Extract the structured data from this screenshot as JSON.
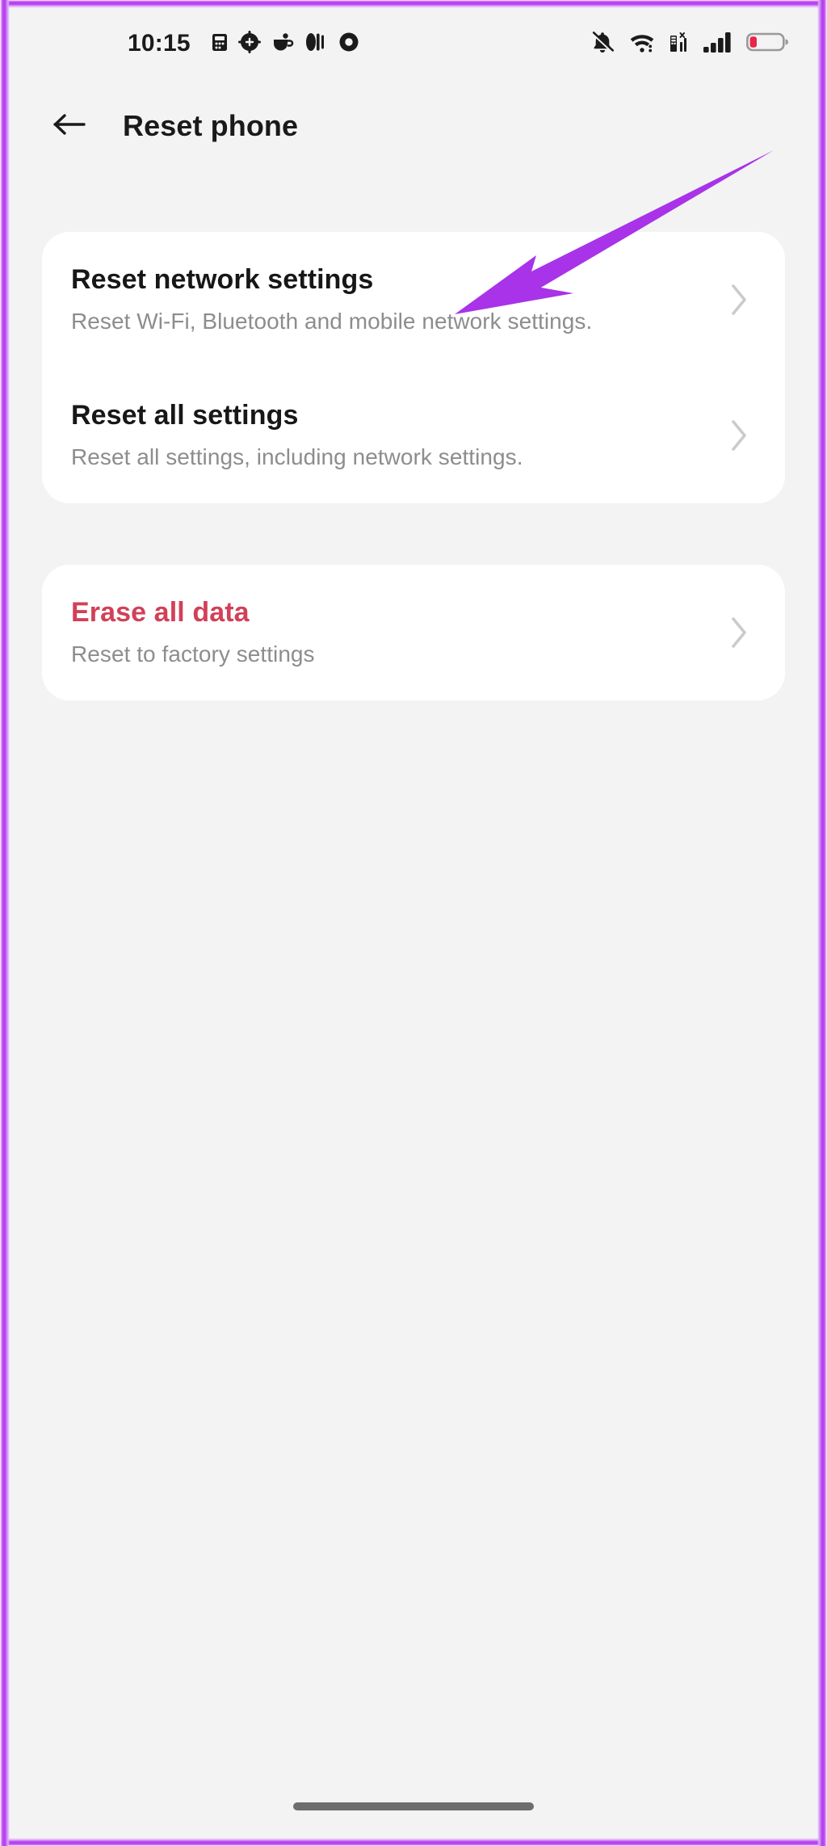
{
  "status_bar": {
    "time": "10:15",
    "left_icons": [
      {
        "name": "calculator-notification-icon"
      },
      {
        "name": "compass-notification-icon"
      },
      {
        "name": "coffee-notification-icon"
      },
      {
        "name": "music-notification-icon"
      },
      {
        "name": "recorder-notification-icon"
      }
    ],
    "right_icons": [
      {
        "name": "notifications-muted-icon"
      },
      {
        "name": "wifi-icon"
      },
      {
        "name": "sim-signal-icon"
      },
      {
        "name": "cellular-signal-icon"
      },
      {
        "name": "battery-low-icon"
      }
    ],
    "battery_level_percent": 15
  },
  "app_bar": {
    "back_label": "Back",
    "title": "Reset phone"
  },
  "cards": [
    {
      "id": "reset-settings-card",
      "rows": [
        {
          "id": "reset-network-settings",
          "title": "Reset network settings",
          "subtitle": "Reset Wi-Fi, Bluetooth and mobile network settings.",
          "danger": false
        },
        {
          "id": "reset-all-settings",
          "title": "Reset all settings",
          "subtitle": "Reset all settings, including network settings.",
          "danger": false
        }
      ]
    },
    {
      "id": "erase-card",
      "rows": [
        {
          "id": "erase-all-data",
          "title": "Erase all data",
          "subtitle": "Reset to factory settings",
          "danger": true
        }
      ]
    }
  ],
  "annotation": {
    "name": "highlight-arrow",
    "points_to": "Reset network settings",
    "color": "#a833e8"
  },
  "colors": {
    "screen_background": "#f3f3f3",
    "card_background": "#ffffff",
    "title_text": "#171717",
    "subtitle_text": "#8d8d8d",
    "danger_text": "#d24058",
    "chevron": "#cccccc",
    "frame_accent": "#b13df0"
  },
  "home_indicator": {
    "name": "home-gesture-bar"
  }
}
